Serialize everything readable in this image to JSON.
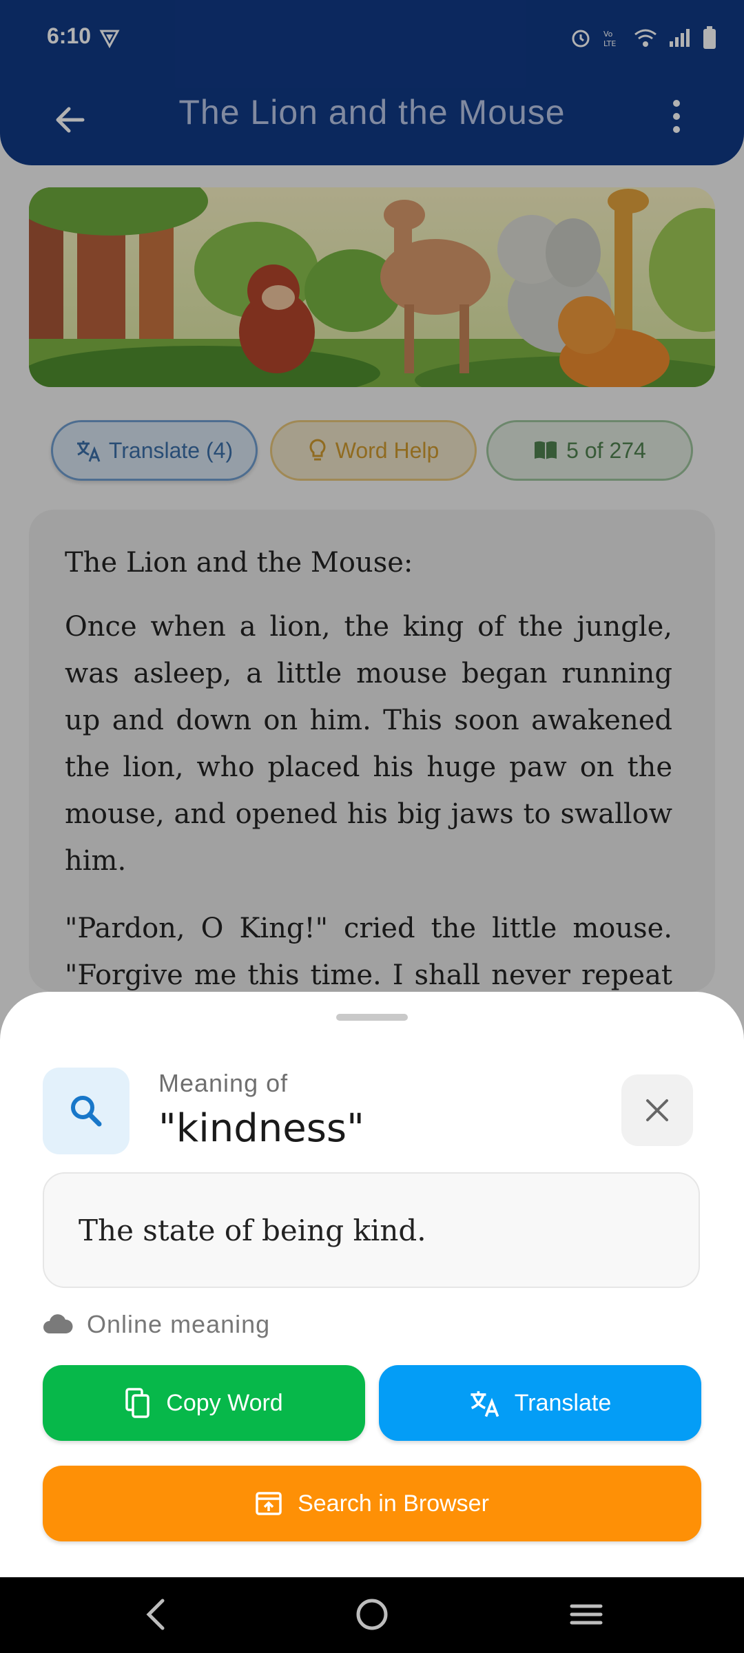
{
  "status_bar": {
    "time": "6:10"
  },
  "header": {
    "title": "The Lion and the Mouse"
  },
  "chips": {
    "translate": "Translate (4)",
    "word_help": "Word Help",
    "page": "5 of 274"
  },
  "story": {
    "title": "The Lion and the Mouse:",
    "paragraphs": [
      "Once when a lion, the king of the jungle, was asleep, a little mouse began running up and down on him. This soon awakened the lion, who placed his huge paw on the mouse, and opened his big jaws to swallow him.",
      "\"Pardon, O King!\" cried the little mouse. \"Forgive me this time. I shall never repeat it and I shall never forget your kindness. And"
    ]
  },
  "sheet": {
    "label": "Meaning of",
    "word": "\"kindness\"",
    "definition": "The state of being kind.",
    "source": "Online meaning",
    "copy_button": "Copy Word",
    "translate_button": "Translate",
    "search_button": "Search in Browser"
  },
  "colors": {
    "appbar": "#113a86",
    "copy": "#07b84a",
    "translate": "#049df6",
    "search": "#fe9006"
  }
}
